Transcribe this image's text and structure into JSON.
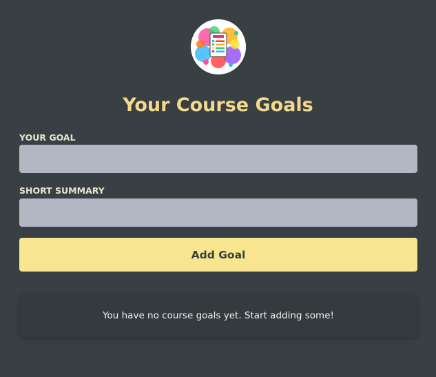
{
  "header": {
    "logo_icon": "goals-checklist-logo",
    "title": "Your Course Goals"
  },
  "form": {
    "goal_label": "Your Goal",
    "goal_value": "",
    "summary_label": "Short Summary",
    "summary_value": "",
    "submit_label": "Add Goal"
  },
  "goals": {
    "empty_message": "You have no course goals yet. Start adding some!"
  },
  "colors": {
    "background": "#384044",
    "accent": "#f5d98a",
    "button": "#f8e58f",
    "input": "#b3b6c3",
    "card": "#343b3f"
  }
}
